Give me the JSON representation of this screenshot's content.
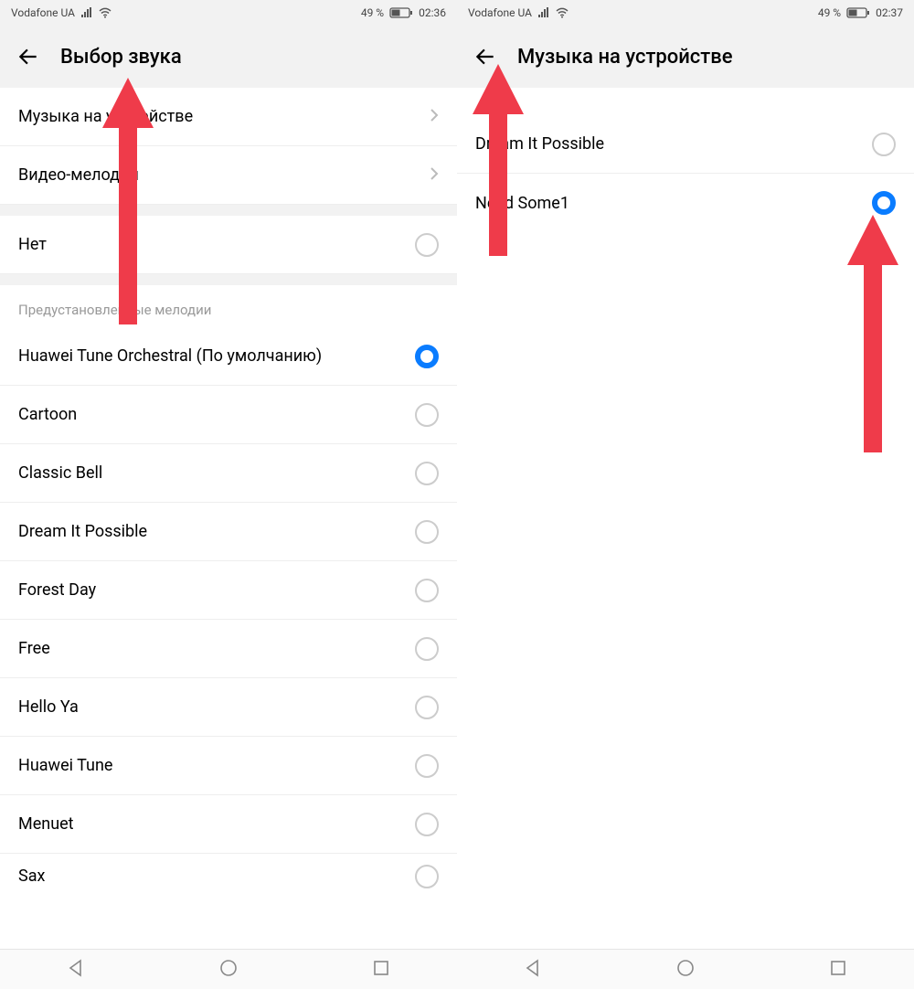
{
  "left": {
    "statusbar": {
      "carrier": "Vodafone UA",
      "battery_text": "49 %",
      "time": "02:36"
    },
    "header": {
      "title": "Выбор звука"
    },
    "nav_items": [
      {
        "label": "Музыка на устройстве"
      },
      {
        "label": "Видео-мелодии"
      }
    ],
    "none_option": {
      "label": "Нет"
    },
    "section_title": "Предустановленные мелодии",
    "ringtones": [
      {
        "label": "Huawei Tune Orchestral (По умолчанию)",
        "selected": true
      },
      {
        "label": "Cartoon",
        "selected": false
      },
      {
        "label": "Classic Bell",
        "selected": false
      },
      {
        "label": "Dream It Possible",
        "selected": false
      },
      {
        "label": "Forest Day",
        "selected": false
      },
      {
        "label": "Free",
        "selected": false
      },
      {
        "label": "Hello Ya",
        "selected": false
      },
      {
        "label": "Huawei Tune",
        "selected": false
      },
      {
        "label": "Menuet",
        "selected": false
      },
      {
        "label": "Sax",
        "selected": false
      }
    ]
  },
  "right": {
    "statusbar": {
      "carrier": "Vodafone UA",
      "battery_text": "49 %",
      "time": "02:37"
    },
    "header": {
      "title": "Музыка на устройстве"
    },
    "tracks": [
      {
        "label": "Dream It Possible",
        "selected": false
      },
      {
        "label": "Need Some1",
        "selected": true
      }
    ]
  }
}
